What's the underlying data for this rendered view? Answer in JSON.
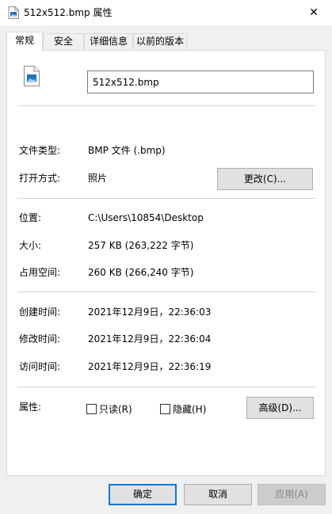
{
  "window": {
    "title": "512x512.bmp 属性",
    "close_glyph": "✕"
  },
  "tabs": [
    {
      "label": "常规",
      "active": true
    },
    {
      "label": "安全",
      "active": false
    },
    {
      "label": "详细信息",
      "active": false
    },
    {
      "label": "以前的版本",
      "active": false
    }
  ],
  "general": {
    "file_name": "512x512.bmp",
    "file_type_label": "文件类型:",
    "file_type_value": "BMP 文件 (.bmp)",
    "opens_with_label": "打开方式:",
    "opens_with_value": "照片",
    "change_button": "更改(C)...",
    "location_label": "位置:",
    "location_value": "C:\\Users\\10854\\Desktop",
    "size_label": "大小:",
    "size_value": "257 KB (263,222 字节)",
    "size_on_disk_label": "占用空间:",
    "size_on_disk_value": "260 KB (266,240 字节)",
    "created_label": "创建时间:",
    "created_value": "2021年12月9日，22:36:03",
    "modified_label": "修改时间:",
    "modified_value": "2021年12月9日，22:36:04",
    "accessed_label": "访问时间:",
    "accessed_value": "2021年12月9日，22:36:19",
    "attributes_label": "属性:",
    "readonly_label": "只读(R)",
    "readonly_checked": false,
    "hidden_label": "隐藏(H)",
    "hidden_checked": false,
    "advanced_button": "高级(D)..."
  },
  "footer": {
    "ok": "确定",
    "cancel": "取消",
    "apply": "应用(A)"
  },
  "colors": {
    "accent": "#0078d7",
    "image_icon": "#1e73be"
  },
  "icons": {
    "title": "image-file-icon",
    "file": "image-file-icon",
    "close": "close-icon"
  }
}
